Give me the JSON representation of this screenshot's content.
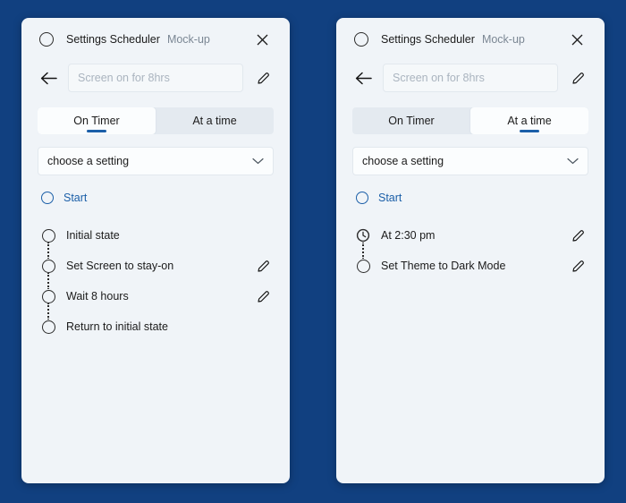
{
  "theme": {
    "background": "#114080",
    "panel_bg": "#f0f4f8",
    "accent": "#1b5fa8",
    "text": "#1b1b1b",
    "muted": "#7b8794",
    "placeholder": "#aab4bf"
  },
  "panels": [
    {
      "id": "on-timer-panel",
      "titlebar": {
        "app_icon": "circle-icon",
        "title": "Settings Scheduler",
        "subtitle": "Mock-up",
        "close_icon": "close-icon"
      },
      "namerow": {
        "back_icon": "arrow-left-icon",
        "input_value": "",
        "input_placeholder": "Screen on for 8hrs",
        "edit_icon": "pencil-icon"
      },
      "tabs": [
        {
          "label": "On Timer",
          "active": true
        },
        {
          "label": "At a time",
          "active": false
        }
      ],
      "dropdown": {
        "value": "choose a setting",
        "chevron_icon": "chevron-down-icon"
      },
      "start": {
        "label": "Start",
        "icon": "circle-icon"
      },
      "steps": [
        {
          "label": "Initial state",
          "icon": "circle-icon",
          "edit": false
        },
        {
          "label": "Set Screen to stay-on",
          "icon": "circle-icon",
          "edit": true
        },
        {
          "label": "Wait 8 hours",
          "icon": "circle-icon",
          "edit": true
        },
        {
          "label": "Return to initial state",
          "icon": "circle-icon",
          "edit": false
        }
      ]
    },
    {
      "id": "at-a-time-panel",
      "titlebar": {
        "app_icon": "circle-icon",
        "title": "Settings Scheduler",
        "subtitle": "Mock-up",
        "close_icon": "close-icon"
      },
      "namerow": {
        "back_icon": "arrow-left-icon",
        "input_value": "",
        "input_placeholder": "Screen on for 8hrs",
        "edit_icon": "pencil-icon"
      },
      "tabs": [
        {
          "label": "On Timer",
          "active": false
        },
        {
          "label": "At a time",
          "active": true
        }
      ],
      "dropdown": {
        "value": "choose a setting",
        "chevron_icon": "chevron-down-icon"
      },
      "start": {
        "label": "Start",
        "icon": "circle-icon"
      },
      "steps": [
        {
          "label": "At 2:30 pm",
          "icon": "clock-icon",
          "edit": true
        },
        {
          "label": "Set Theme to Dark Mode",
          "icon": "circle-icon",
          "edit": true
        }
      ]
    }
  ]
}
